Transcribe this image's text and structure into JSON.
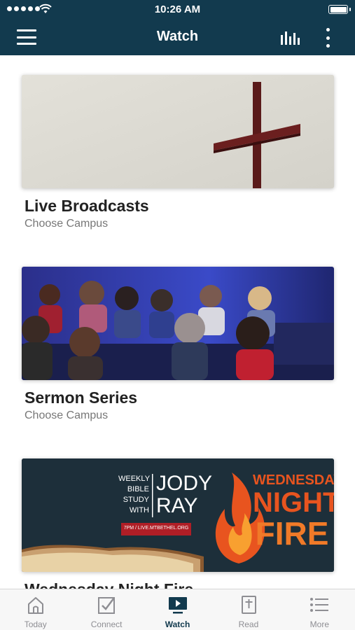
{
  "status_bar": {
    "time": "10:26 AM"
  },
  "header": {
    "title": "Watch"
  },
  "cards": [
    {
      "title": "Live Broadcasts",
      "subtitle": "Choose Campus",
      "image": "cross-image"
    },
    {
      "title": "Sermon Series",
      "subtitle": "Choose Campus",
      "image": "audience-image"
    },
    {
      "title": "Wednesday Night Fire",
      "subtitle": "",
      "image": "wednesday-night-fire-banner",
      "banner": {
        "weekly_lines": [
          "WEEKLY",
          "BIBLE",
          "STUDY",
          "WITH"
        ],
        "speaker_first": "JODY",
        "speaker_last": "RAY",
        "time_url": "7PM / LIVE.MTBETHEL.ORG",
        "event_lines": [
          "WEDNESDAY",
          "NIGHT",
          "FIRE"
        ]
      }
    }
  ],
  "tabs": [
    {
      "label": "Today",
      "icon": "home-icon",
      "active": false
    },
    {
      "label": "Connect",
      "icon": "checkbox-icon",
      "active": false
    },
    {
      "label": "Watch",
      "icon": "tv-play-icon",
      "active": true
    },
    {
      "label": "Read",
      "icon": "bible-icon",
      "active": false
    },
    {
      "label": "More",
      "icon": "list-icon",
      "active": false
    }
  ],
  "colors": {
    "header": "#123a4e",
    "tab_active": "#123a4e",
    "tab_inactive": "#8e8e93",
    "banner_orange": "#e8541f"
  }
}
